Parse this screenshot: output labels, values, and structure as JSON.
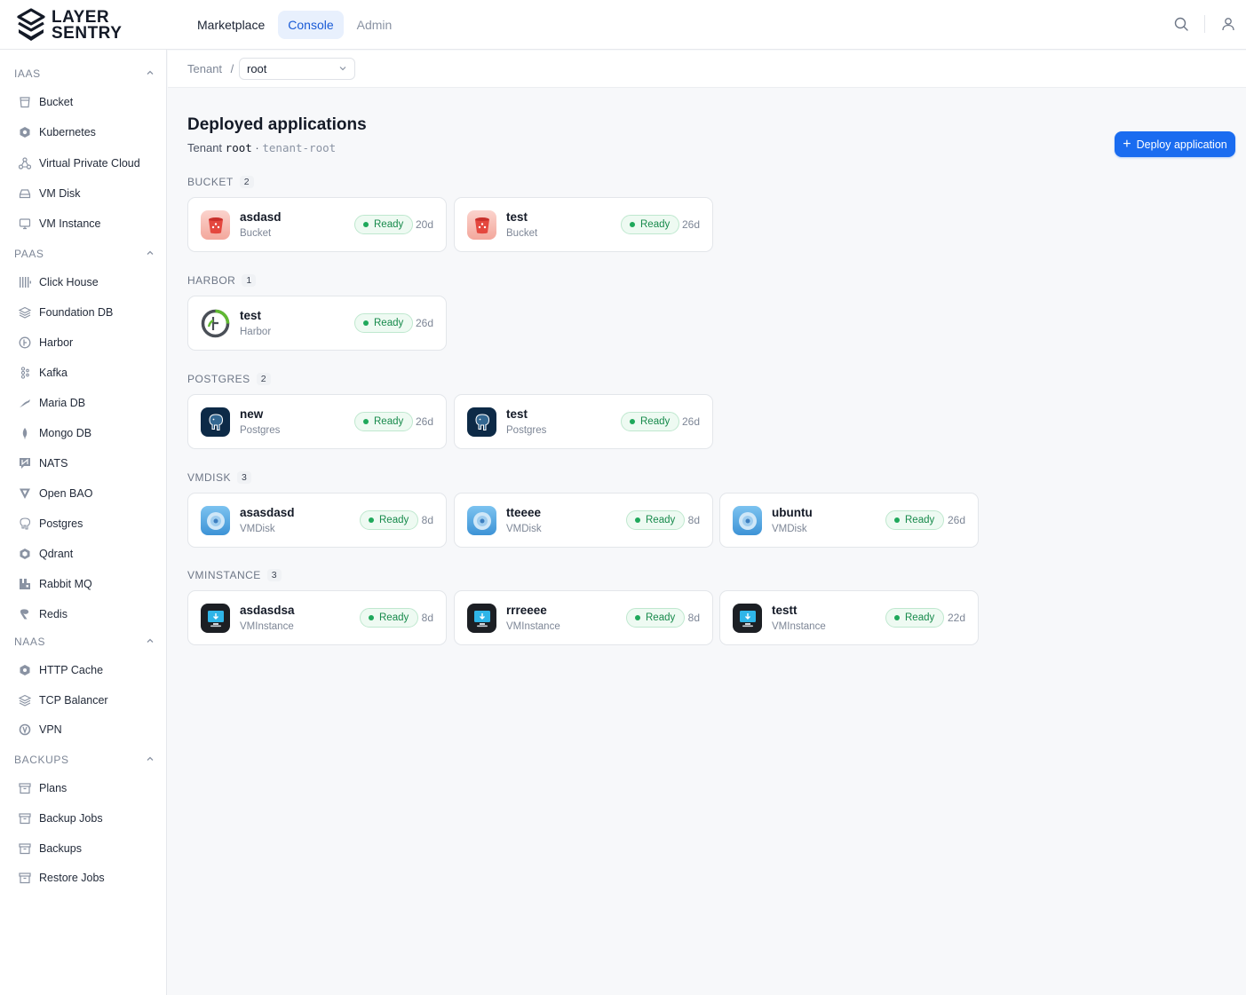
{
  "brand": {
    "line1": "LAYER",
    "line2": "SENTRY"
  },
  "nav": {
    "items": [
      "Marketplace",
      "Console",
      "Admin"
    ]
  },
  "header_icons": [
    "search-icon",
    "user-icon"
  ],
  "sidebar": {
    "sections": [
      {
        "title": "IAAS",
        "items": [
          "Bucket",
          "Kubernetes",
          "Virtual Private Cloud",
          "VM Disk",
          "VM Instance"
        ]
      },
      {
        "title": "PAAS",
        "items": [
          "Click House",
          "Foundation DB",
          "Harbor",
          "Kafka",
          "Maria DB",
          "Mongo DB",
          "NATS",
          "Open BAO",
          "Postgres",
          "Qdrant",
          "Rabbit MQ",
          "Redis"
        ]
      },
      {
        "title": "NAAS",
        "items": [
          "HTTP Cache",
          "TCP Balancer",
          "VPN"
        ]
      },
      {
        "title": "BACKUPS",
        "items": [
          "Plans",
          "Backup Jobs",
          "Backups",
          "Restore Jobs"
        ]
      }
    ]
  },
  "breadcrumb": {
    "label": "Tenant",
    "separator": "/",
    "selected": "root"
  },
  "page": {
    "title": "Deployed applications",
    "subtitle_prefix": "Tenant",
    "tenant": "root",
    "separator": "·",
    "namespace": "tenant-root",
    "deploy_label": "Deploy application"
  },
  "groups": [
    {
      "title": "BUCKET",
      "count": "2",
      "apps": [
        {
          "name": "asdasd",
          "kind": "Bucket",
          "status": "Ready",
          "age": "20d"
        },
        {
          "name": "test",
          "kind": "Bucket",
          "status": "Ready",
          "age": "26d"
        }
      ]
    },
    {
      "title": "HARBOR",
      "count": "1",
      "apps": [
        {
          "name": "test",
          "kind": "Harbor",
          "status": "Ready",
          "age": "26d"
        }
      ]
    },
    {
      "title": "POSTGRES",
      "count": "2",
      "apps": [
        {
          "name": "new",
          "kind": "Postgres",
          "status": "Ready",
          "age": "26d"
        },
        {
          "name": "test",
          "kind": "Postgres",
          "status": "Ready",
          "age": "26d"
        }
      ]
    },
    {
      "title": "VMDISK",
      "count": "3",
      "apps": [
        {
          "name": "asasdasd",
          "kind": "VMDisk",
          "status": "Ready",
          "age": "8d"
        },
        {
          "name": "tteeee",
          "kind": "VMDisk",
          "status": "Ready",
          "age": "8d"
        },
        {
          "name": "ubuntu",
          "kind": "VMDisk",
          "status": "Ready",
          "age": "26d"
        }
      ]
    },
    {
      "title": "VMINSTANCE",
      "count": "3",
      "apps": [
        {
          "name": "asdasdsa",
          "kind": "VMInstance",
          "status": "Ready",
          "age": "8d"
        },
        {
          "name": "rrreeee",
          "kind": "VMInstance",
          "status": "Ready",
          "age": "8d"
        },
        {
          "name": "testt",
          "kind": "VMInstance",
          "status": "Ready",
          "age": "22d"
        }
      ]
    }
  ],
  "colors": {
    "accent": "#1a6cf0",
    "ready": "#1fa85b",
    "nav_active_bg": "#e8f0fd"
  }
}
